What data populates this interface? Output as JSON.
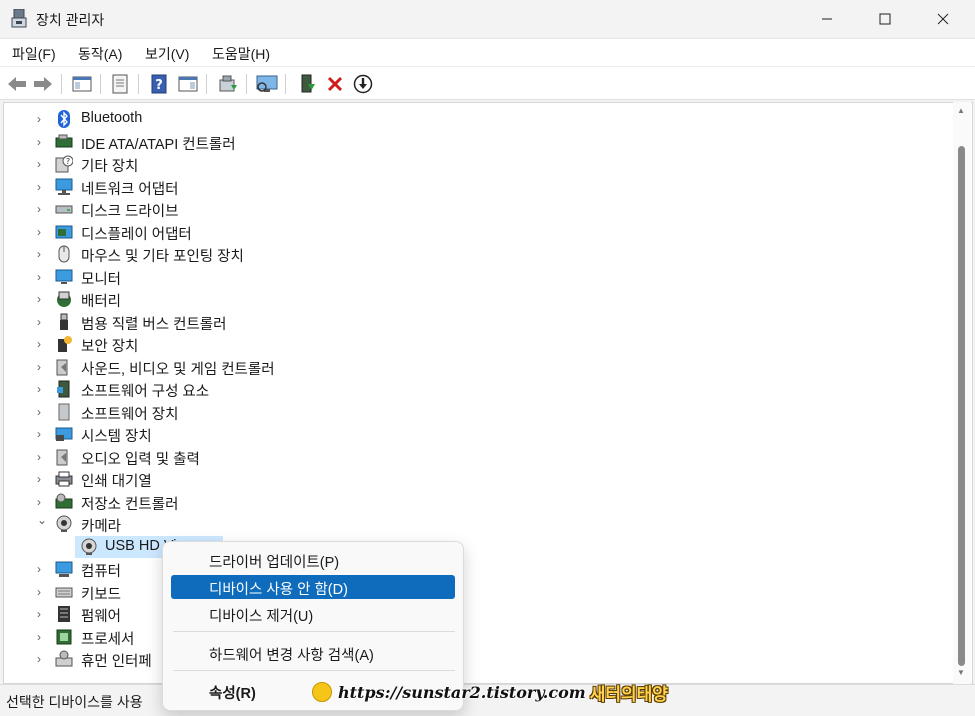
{
  "window": {
    "title": "장치 관리자",
    "icon": "device-manager-icon",
    "controls": [
      "minimize-icon",
      "maximize-icon",
      "close-icon"
    ]
  },
  "menubar": {
    "items": [
      "파일(F)",
      "동작(A)",
      "보기(V)",
      "도움말(H)"
    ]
  },
  "toolbar": {
    "buttons": [
      "back-arrow-icon",
      "forward-arrow-icon",
      "show-hide-console-tree-icon",
      "properties-icon",
      "help-icon",
      "action-pane-icon",
      "update-driver-icon",
      "scan-hardware-icon",
      "enable-device-icon",
      "uninstall-device-icon",
      "disable-device-icon"
    ]
  },
  "tree": {
    "categories": [
      {
        "label": "Bluetooth",
        "icon": "bluetooth-icon",
        "expanded": false
      },
      {
        "label": "IDE ATA/ATAPI 컨트롤러",
        "icon": "ide-controller-icon",
        "expanded": false
      },
      {
        "label": "기타 장치",
        "icon": "unknown-device-icon",
        "expanded": false
      },
      {
        "label": "네트워크 어댑터",
        "icon": "network-adapter-icon",
        "expanded": false
      },
      {
        "label": "디스크 드라이브",
        "icon": "disk-drive-icon",
        "expanded": false
      },
      {
        "label": "디스플레이 어댑터",
        "icon": "display-adapter-icon",
        "expanded": false
      },
      {
        "label": "마우스 및 기타 포인팅 장치",
        "icon": "mouse-icon",
        "expanded": false
      },
      {
        "label": "모니터",
        "icon": "monitor-icon",
        "expanded": false
      },
      {
        "label": "배터리",
        "icon": "battery-icon",
        "expanded": false
      },
      {
        "label": "범용 직렬 버스 컨트롤러",
        "icon": "usb-icon",
        "expanded": false
      },
      {
        "label": "보안 장치",
        "icon": "security-device-icon",
        "expanded": false
      },
      {
        "label": "사운드, 비디오 및 게임 컨트롤러",
        "icon": "speaker-icon",
        "expanded": false
      },
      {
        "label": "소프트웨어 구성 요소",
        "icon": "software-component-icon",
        "expanded": false
      },
      {
        "label": "소프트웨어 장치",
        "icon": "software-device-icon",
        "expanded": false
      },
      {
        "label": "시스템 장치",
        "icon": "system-device-icon",
        "expanded": false
      },
      {
        "label": "오디오 입력 및 출력",
        "icon": "audio-io-icon",
        "expanded": false
      },
      {
        "label": "인쇄 대기열",
        "icon": "printer-icon",
        "expanded": false
      },
      {
        "label": "저장소 컨트롤러",
        "icon": "storage-controller-icon",
        "expanded": false
      },
      {
        "label": "카메라",
        "icon": "camera-icon",
        "expanded": true
      },
      {
        "label": "컴퓨터",
        "icon": "computer-icon",
        "expanded": false
      },
      {
        "label": "키보드",
        "icon": "keyboard-icon",
        "expanded": false
      },
      {
        "label": "펌웨어",
        "icon": "firmware-icon",
        "expanded": false
      },
      {
        "label": "프로세서",
        "icon": "processor-icon",
        "expanded": false
      },
      {
        "label": "휴먼 인터페",
        "icon": "hid-icon",
        "expanded": false
      }
    ],
    "camera_child": {
      "label": "USB HD Vi",
      "icon": "webcam-icon"
    }
  },
  "context_menu": {
    "items": [
      {
        "label": "드라이버 업데이트(P)",
        "highlighted": false,
        "bold": false
      },
      {
        "label": "디바이스 사용 안 함(D)",
        "highlighted": true,
        "bold": false
      },
      {
        "label": "디바이스 제거(U)",
        "highlighted": false,
        "bold": false
      },
      {
        "label": "하드웨어 변경 사항 검색(A)",
        "highlighted": false,
        "bold": false
      },
      {
        "label": "속성(R)",
        "highlighted": false,
        "bold": true
      }
    ],
    "highlight_color": "#0f6cbd"
  },
  "statusbar": {
    "text": "선택한 디바이스를 사용"
  },
  "watermark": {
    "url": "https://sunstar2.tistory.com",
    "name": "새터의태양"
  },
  "colors": {
    "selection_bg": "#cce8ff",
    "accent": "#0f6cbd"
  }
}
